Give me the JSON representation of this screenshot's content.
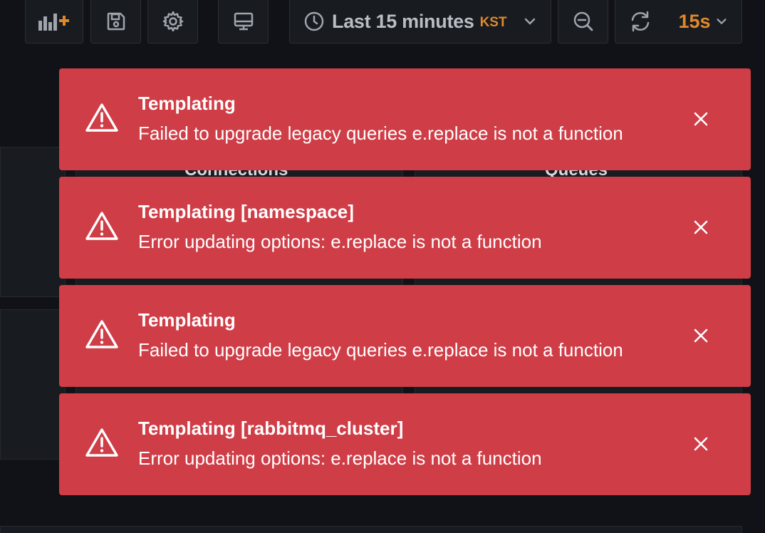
{
  "toolbar": {
    "time_picker": {
      "label": "Last 15 minutes",
      "timezone": "KST"
    },
    "refresh": {
      "interval": "15s"
    }
  },
  "background_panels": {
    "left_title": "Connections",
    "right_title": "Queues"
  },
  "alerts": [
    {
      "title": "Templating",
      "text": "Failed to upgrade legacy queries e.replace is not a function"
    },
    {
      "title": "Templating [namespace]",
      "text": "Error updating options: e.replace is not a function"
    },
    {
      "title": "Templating",
      "text": "Failed to upgrade legacy queries e.replace is not a function"
    },
    {
      "title": "Templating [rabbitmq_cluster]",
      "text": "Error updating options: e.replace is not a function"
    }
  ],
  "colors": {
    "alert_background": "#cf3d47",
    "page_background": "#111217",
    "accent_orange": "#e0882e"
  },
  "icons": {
    "add_panel": "add-panel-icon",
    "save": "save-icon",
    "settings": "gear-icon",
    "tv_mode": "monitor-icon",
    "clock": "clock-icon",
    "zoom_out": "zoom-out-icon",
    "refresh": "refresh-icon",
    "warning": "warning-triangle-icon",
    "close": "close-icon"
  }
}
